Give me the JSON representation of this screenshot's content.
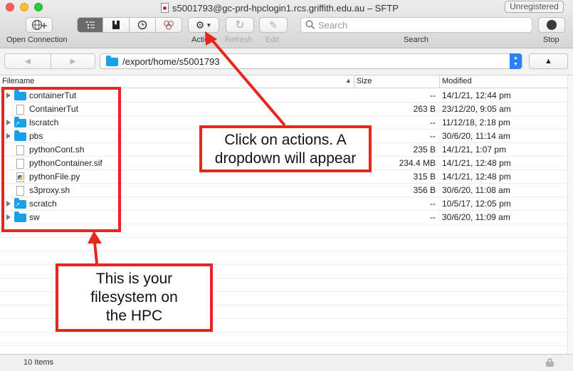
{
  "window": {
    "title": "s5001793@gc-prd-hpclogin1.rcs.griffith.edu.au – SFTP",
    "unregistered": "Unregistered"
  },
  "toolbar": {
    "open_connection": "Open Connection",
    "action": "Action",
    "refresh": "Refresh",
    "edit": "Edit",
    "search_label": "Search",
    "search_placeholder": "Search",
    "stop": "Stop"
  },
  "path": {
    "current": "/export/home/s5001793"
  },
  "columns": {
    "filename": "Filename",
    "size": "Size",
    "modified": "Modified"
  },
  "files": [
    {
      "name": "containerTut",
      "kind": "folder",
      "size": "--",
      "modified": "14/1/21, 12:44 pm"
    },
    {
      "name": "ContainerTut",
      "kind": "file",
      "size": "263 B",
      "modified": "23/12/20, 9:05 am"
    },
    {
      "name": "lscratch",
      "kind": "folder-link",
      "size": "--",
      "modified": "11/12/18, 2:18 pm"
    },
    {
      "name": "pbs",
      "kind": "folder",
      "size": "--",
      "modified": "30/6/20, 11:14 am"
    },
    {
      "name": "pythonCont.sh",
      "kind": "file",
      "size": "235 B",
      "modified": "14/1/21, 1:07 pm"
    },
    {
      "name": "pythonContainer.sif",
      "kind": "file",
      "size": "234.4 MB",
      "modified": "14/1/21, 12:48 pm"
    },
    {
      "name": "pythonFile.py",
      "kind": "python",
      "size": "315 B",
      "modified": "14/1/21, 12:48 pm"
    },
    {
      "name": "s3proxy.sh",
      "kind": "file",
      "size": "356 B",
      "modified": "30/6/20, 11:08 am"
    },
    {
      "name": "scratch",
      "kind": "folder-link",
      "size": "--",
      "modified": "10/5/17, 12:05 pm"
    },
    {
      "name": "sw",
      "kind": "folder",
      "size": "--",
      "modified": "30/6/20, 11:09 am"
    }
  ],
  "status": {
    "item_count": "10 Items"
  },
  "annotations": {
    "actions_note": "Click on actions. A dropdown will appear",
    "filesystem_note": "This is your filesystem on the HPC"
  },
  "colors": {
    "annotation_red": "#e8261f",
    "folder_blue": "#1aa0e8",
    "select_blue": "#2d7ff5"
  }
}
